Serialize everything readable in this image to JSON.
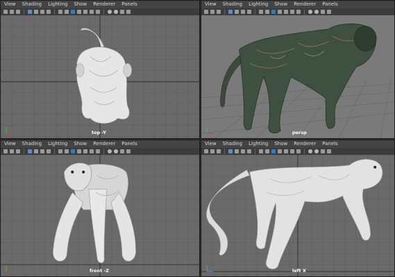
{
  "menu": [
    "View",
    "Shading",
    "Lighting",
    "Show",
    "Renderer",
    "Panels"
  ],
  "viewports": [
    {
      "id": "top",
      "label": "top -Y"
    },
    {
      "id": "persp",
      "label": "persp"
    },
    {
      "id": "front",
      "label": "front -Z"
    },
    {
      "id": "left",
      "label": "left X"
    }
  ],
  "colors": {
    "panel_bg": "#6a6a6a",
    "persp_bg": "#7a7a7a",
    "menu_bg": "#444444",
    "toolbar_bg": "#3c3c3c",
    "accent": "#2f7fc0"
  },
  "icons": [
    "camera-icon",
    "frame-all-icon",
    "grid-icon",
    "wireframe-icon",
    "smooth-shade-icon",
    "textured-icon",
    "lights-icon",
    "isolate-icon",
    "xray-icon",
    "resolution-gate-icon"
  ]
}
